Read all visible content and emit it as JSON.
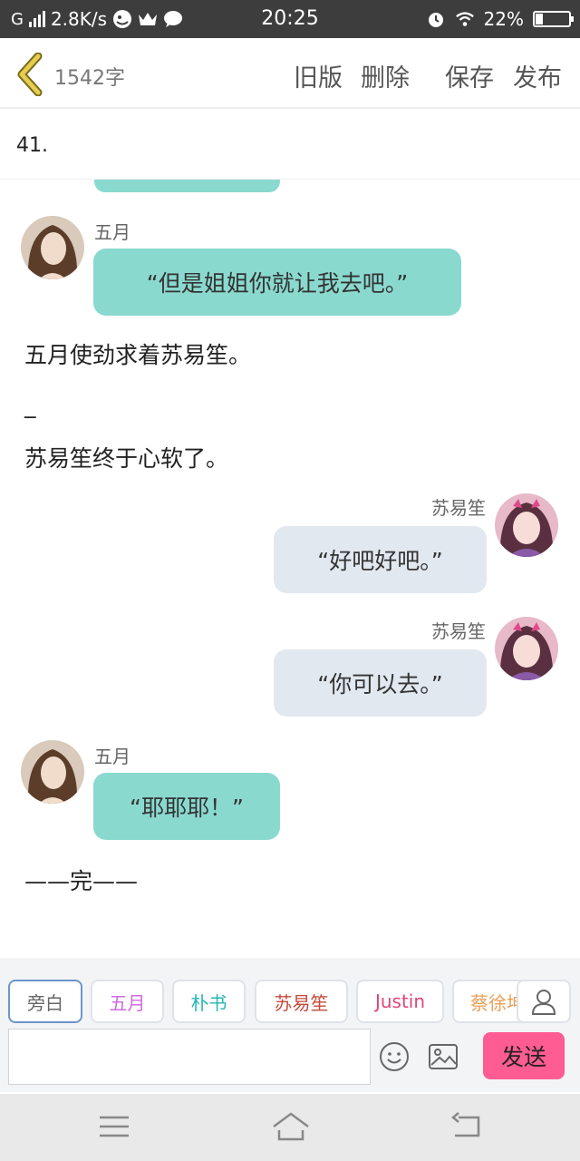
{
  "status_bar": {
    "network_type": "G",
    "speed": "2.8K/s",
    "time": "20:25",
    "battery": "22%",
    "battery_level": 0.22,
    "icons": [
      "signal-icon",
      "app-icon",
      "crown-icon",
      "chat-icon",
      "alarm-icon",
      "wifi-icon",
      "battery-icon"
    ]
  },
  "header": {
    "word_count": "1542字",
    "actions": {
      "old_version": "旧版",
      "delete": "删除",
      "save": "保存",
      "publish": "发布"
    },
    "accent_color": "#c9ad3a"
  },
  "title": {
    "text": "41."
  },
  "chat": {
    "messages": [
      {
        "speaker": "五月",
        "text": "“但是姐姐你就让我去吧。”"
      },
      {
        "narration": "五月使劲求着苏易笙。"
      },
      {
        "narration": "_"
      },
      {
        "narration": "苏易笙终于心软了。"
      },
      {
        "speaker": "苏易笙",
        "text": "“好吧好吧。”"
      },
      {
        "speaker": "苏易笙",
        "text": "“你可以去。”"
      },
      {
        "speaker": "五月",
        "text": "“耶耶耶！”"
      },
      {
        "narration": "——完——"
      }
    ],
    "colors": {
      "left_bubble": "#8ad9cf",
      "right_bubble": "#e2e8f0"
    }
  },
  "input": {
    "roles": [
      {
        "label": "旁白",
        "color": "#666666"
      },
      {
        "label": "五月",
        "color": "#d06be0"
      },
      {
        "label": "朴书",
        "color": "#26b5b5"
      },
      {
        "label": "苏易笙",
        "color": "#c44a3a"
      },
      {
        "label": "Justin",
        "color": "#e0457a"
      },
      {
        "label": "蔡徐坤",
        "color": "#e8a05a"
      }
    ],
    "placeholder": "",
    "send_label": "发送",
    "send_color": "#ff5c93"
  },
  "nav_bar": {
    "icons": [
      "menu-icon",
      "home-icon",
      "back-icon"
    ]
  }
}
